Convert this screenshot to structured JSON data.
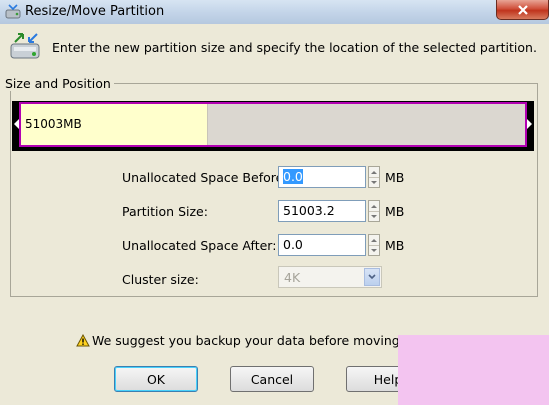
{
  "window": {
    "title": "Resize/Move Partition"
  },
  "header": {
    "instruction": "Enter the new partition size and specify the location of the selected partition."
  },
  "size_position": {
    "title": "Size and Position",
    "bar_label": "51003MB",
    "used_fraction": 0.37,
    "colors": {
      "used": "#ffffcc",
      "free": "#dbd7d0",
      "border": "#b200b2"
    }
  },
  "fields": {
    "before_label": "Unallocated Space Before:",
    "before_value": "0.0",
    "size_label": "Partition Size:",
    "size_value": "51003.2",
    "after_label": "Unallocated Space After:",
    "after_value": "0.0",
    "unit": "MB",
    "cluster_label": "Cluster size:",
    "cluster_value": "4K"
  },
  "warning": {
    "text": "We suggest you backup your data before moving or re"
  },
  "buttons": {
    "ok": "OK",
    "cancel": "Cancel",
    "help": "Help"
  },
  "icons": {
    "title": "partition-tool-icon",
    "header": "drive-resize-icon",
    "warning": "warning-icon",
    "close": "close-icon"
  }
}
